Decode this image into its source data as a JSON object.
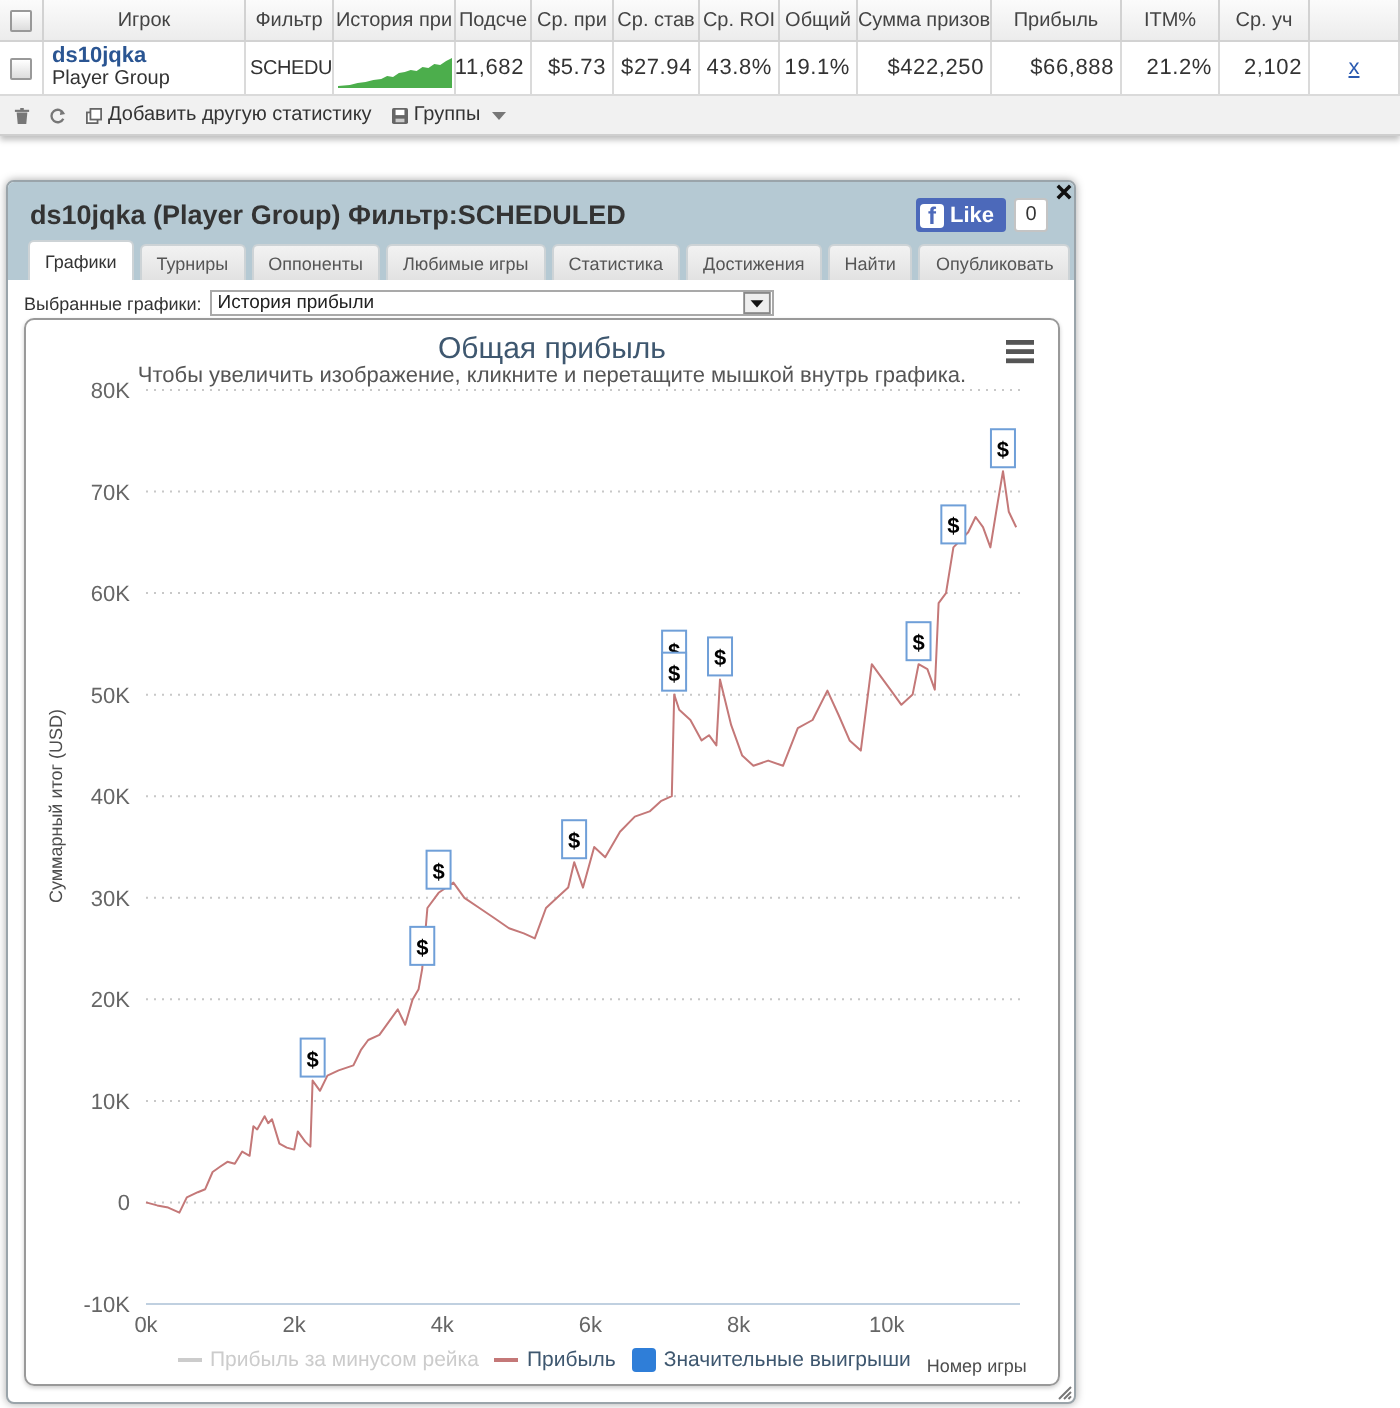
{
  "stats_table": {
    "select_all_checked": false,
    "columns": [
      "Игрок",
      "Фильтр",
      "История при",
      "Подсче",
      "Ср. при",
      "Ср. став",
      "Ср. ROI",
      "Общий",
      "Сумма призов",
      "Прибыль",
      "ITM%",
      "Ср. уч"
    ],
    "rows": [
      {
        "checked": false,
        "player": "ds10jqka",
        "group": "Player Group",
        "filter": "SCHEDU",
        "values": [
          "11,682",
          "$5.73",
          "$27.94",
          "43.8%",
          "19.1%",
          "$422,250",
          "$66,888",
          "21.2%",
          "2,102"
        ],
        "remove_link": "x"
      }
    ]
  },
  "toolbar": {
    "add_statistic": "Добавить другую статистику",
    "groups": "Группы"
  },
  "dialog": {
    "title": "ds10jqka (Player Group) Фильтр:SCHEDULED",
    "like": {
      "icon_letter": "f",
      "label": "Like",
      "count": "0"
    },
    "tabs": [
      {
        "label": "Графики",
        "selected": true
      },
      {
        "label": "Турниры",
        "selected": false
      },
      {
        "label": "Оппоненты",
        "selected": false
      },
      {
        "label": "Любимые игры",
        "selected": false
      },
      {
        "label": "Статистика",
        "selected": false
      },
      {
        "label": "Достижения",
        "selected": false
      },
      {
        "label": "Найти",
        "selected": false
      },
      {
        "label": "Опубликовать",
        "selected": false
      }
    ],
    "chart_select": {
      "label": "Выбранные графики:",
      "value": "История прибыли"
    },
    "chart": {
      "subtitle": "Чтобы увеличить изображение, кликните и перетащите мышкой внутрь графика.",
      "legend": [
        {
          "label": "Прибыль за минусом рейка",
          "kind": "line",
          "hidden": true
        },
        {
          "kind": "series",
          "hidden": false
        },
        {
          "label": "Значительные выигрыши",
          "kind": "square",
          "hidden": false,
          "color": "#2f7ed8"
        }
      ],
      "chart_data": {
        "type": "line",
        "title": "Общая прибыль",
        "xlabel": "Номер игры",
        "ylabel": "Суммарный итог (USD)",
        "grid": true,
        "x": [
          0,
          150,
          300,
          450,
          550,
          700,
          800,
          900,
          1000,
          1100,
          1200,
          1300,
          1400,
          1450,
          1500,
          1600,
          1650,
          1700,
          1800,
          1900,
          2000,
          2050,
          2150,
          2220,
          2250,
          2350,
          2450,
          2600,
          2800,
          2900,
          3000,
          3150,
          3300,
          3400,
          3500,
          3600,
          3680,
          3730,
          3800,
          3950,
          4150,
          4300,
          4500,
          4700,
          4900,
          5100,
          5250,
          5400,
          5550,
          5700,
          5780,
          5900,
          6050,
          6200,
          6400,
          6600,
          6800,
          6950,
          7100,
          7130,
          7200,
          7350,
          7500,
          7600,
          7700,
          7750,
          7900,
          8050,
          8200,
          8400,
          8600,
          8800,
          9000,
          9200,
          9350,
          9500,
          9650,
          9800,
          9900,
          10050,
          10200,
          10350,
          10430,
          10550,
          10650,
          10700,
          10800,
          10900,
          11100,
          11200,
          11300,
          11400,
          11500,
          11570,
          11650,
          11750
        ],
        "series": [
          {
            "name": "Прибыль",
            "color": "#c47878",
            "values": [
              0,
              -300,
              -500,
              -1000,
              500,
              1000,
              1300,
              3000,
              3500,
              4000,
              3800,
              5000,
              4600,
              7500,
              7200,
              8500,
              7800,
              8200,
              5800,
              5400,
              5200,
              7000,
              6000,
              5500,
              12000,
              11000,
              12500,
              13000,
              13500,
              15000,
              16000,
              16500,
              18000,
              19000,
              17500,
              20000,
              21000,
              23000,
              29000,
              30500,
              31500,
              30000,
              29000,
              28000,
              27000,
              26500,
              26000,
              29000,
              30000,
              31000,
              33500,
              31000,
              35000,
              34000,
              36500,
              38000,
              38500,
              39500,
              40000,
              50000,
              48500,
              47500,
              45500,
              46000,
              45000,
              51500,
              47000,
              44000,
              43000,
              43500,
              43000,
              46700,
              47500,
              50400,
              48000,
              45500,
              44500,
              53000,
              52000,
              50500,
              49000,
              50000,
              53000,
              52500,
              50500,
              59000,
              60000,
              64500,
              66000,
              67500,
              66500,
              64500,
              69000,
              72000,
              68000,
              66500
            ]
          }
        ],
        "xlim": [
          0,
          11800
        ],
        "ylim": [
          -10000,
          80000
        ],
        "xticks": [
          {
            "value": 0,
            "label": "0k"
          },
          {
            "value": 2000,
            "label": "2k"
          },
          {
            "value": 4000,
            "label": "4k"
          },
          {
            "value": 6000,
            "label": "6k"
          },
          {
            "value": 8000,
            "label": "8k"
          },
          {
            "value": 10000,
            "label": "10k"
          }
        ],
        "yticks": [
          {
            "value": -10000,
            "label": "-10K"
          },
          0,
          {
            "value": 10000,
            "label": "10K"
          },
          {
            "value": 20000,
            "label": "20K"
          },
          {
            "value": 30000,
            "label": "30K"
          },
          {
            "value": 40000,
            "label": "40K"
          },
          {
            "value": 50000,
            "label": "50K"
          },
          {
            "value": 60000,
            "label": "60K"
          },
          {
            "value": 70000,
            "label": "70K"
          },
          {
            "value": 80000,
            "label": "80K"
          }
        ],
        "annotations": [
          {
            "x": 2250,
            "y": 12000,
            "text": "$"
          },
          {
            "x": 3730,
            "y": 23000,
            "text": "$"
          },
          {
            "x": 3950,
            "y": 30500,
            "text": "$"
          },
          {
            "x": 5780,
            "y": 33500,
            "text": "$"
          },
          {
            "x": 7130,
            "y": 50000,
            "text": "$"
          },
          {
            "x": 7130,
            "y": 50000,
            "text": "$"
          },
          {
            "x": 7750,
            "y": 51500,
            "text": "$"
          },
          {
            "x": 10430,
            "y": 53000,
            "text": "$"
          },
          {
            "x": 10900,
            "y": 64500,
            "text": "$"
          },
          {
            "x": 11570,
            "y": 72000,
            "text": "$"
          }
        ]
      }
    }
  }
}
